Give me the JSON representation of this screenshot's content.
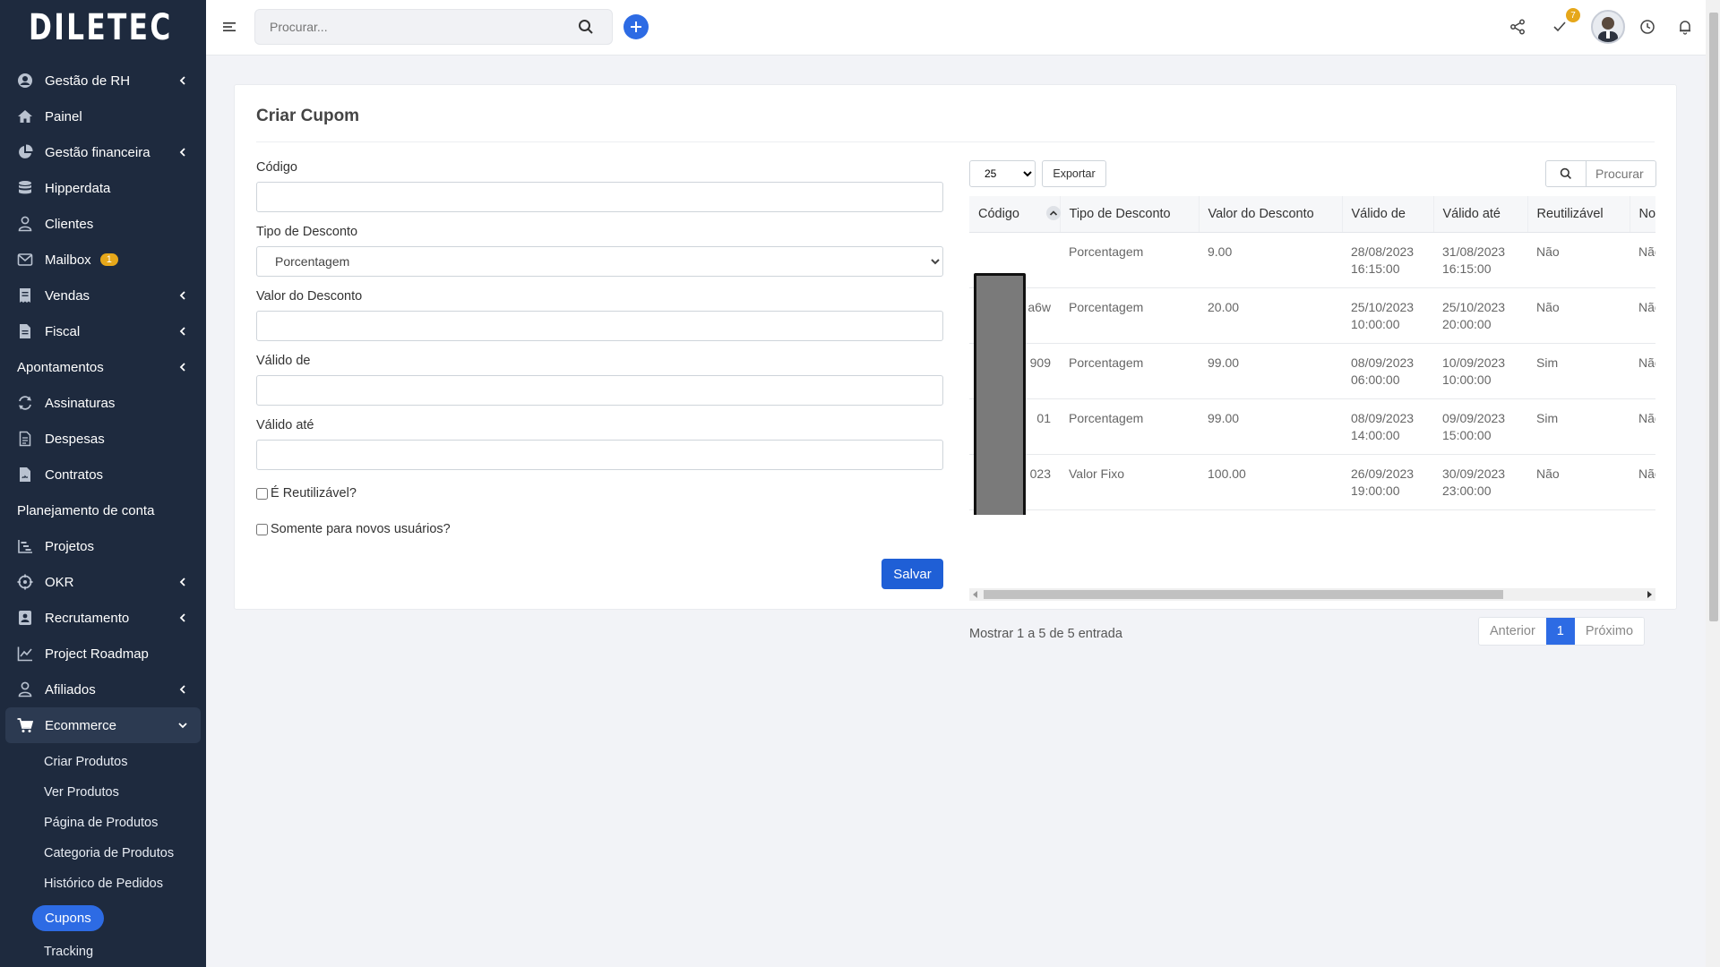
{
  "brand": {
    "name": "DILETEC"
  },
  "sidebar": {
    "items": [
      {
        "label": "Gestão de RH",
        "icon": "user-circle-icon",
        "chevron": true
      },
      {
        "label": "Painel",
        "icon": "home-icon",
        "chevron": false
      },
      {
        "label": "Gestão financeira",
        "icon": "pie-chart-icon",
        "chevron": true
      },
      {
        "label": "Hipperdata",
        "icon": "database-icon",
        "chevron": false
      },
      {
        "label": "Clientes",
        "icon": "user-icon",
        "chevron": false
      },
      {
        "label": "Mailbox",
        "icon": "envelope-icon",
        "chevron": false,
        "badge": "1"
      },
      {
        "label": "Vendas",
        "icon": "receipt-icon",
        "chevron": true
      },
      {
        "label": "Fiscal",
        "icon": "document-icon",
        "chevron": true
      },
      {
        "label": "Apontamentos",
        "icon": "",
        "chevron": true
      },
      {
        "label": "Assinaturas",
        "icon": "refresh-icon",
        "chevron": false
      },
      {
        "label": "Despesas",
        "icon": "file-icon",
        "chevron": false
      },
      {
        "label": "Contratos",
        "icon": "contract-icon",
        "chevron": false
      },
      {
        "label": "Planejamento de conta",
        "icon": "",
        "chevron": false
      },
      {
        "label": "Projetos",
        "icon": "chart-steps-icon",
        "chevron": false
      },
      {
        "label": "OKR",
        "icon": "crosshair-icon",
        "chevron": true
      },
      {
        "label": "Recrutamento",
        "icon": "id-card-icon",
        "chevron": true
      },
      {
        "label": "Project Roadmap",
        "icon": "line-chart-icon",
        "chevron": false
      },
      {
        "label": "Afiliados",
        "icon": "user-icon",
        "chevron": true
      }
    ],
    "ecommerce": {
      "label": "Ecommerce",
      "sub": [
        "Criar Produtos",
        "Ver Produtos",
        "Página de Produtos",
        "Categoria de Produtos",
        "Histórico de Pedidos"
      ],
      "active_sub": "Cupons",
      "after": "Tracking"
    }
  },
  "topbar": {
    "search_placeholder": "Procurar...",
    "tasks_badge": "7"
  },
  "page": {
    "title": "Criar Cupom",
    "form": {
      "codigo_label": "Código",
      "tipo_label": "Tipo de Desconto",
      "tipo_selected": "Porcentagem",
      "valor_label": "Valor do Desconto",
      "valido_de_label": "Válido de",
      "valido_ate_label": "Válido até",
      "reutilizavel_label": "É Reutilizável?",
      "novos_label": "Somente para novos usuários?",
      "save_label": "Salvar"
    },
    "table": {
      "page_length": "25",
      "export_label": "Exportar",
      "search_placeholder": "Procurar",
      "columns": [
        "Código",
        "Tipo de Desconto",
        "Valor do Desconto",
        "Válido de",
        "Válido até",
        "Reutilizável",
        "Novos"
      ],
      "rows": [
        [
          "",
          "Porcentagem",
          "9.00",
          "28/08/2023\n16:15:00",
          "31/08/2023\n16:15:00",
          "Não",
          "Não"
        ],
        [
          "a6w",
          "Porcentagem",
          "20.00",
          "25/10/2023\n10:00:00",
          "25/10/2023\n20:00:00",
          "Não",
          "Não"
        ],
        [
          "909",
          "Porcentagem",
          "99.00",
          "08/09/2023\n06:00:00",
          "10/09/2023\n10:00:00",
          "Sim",
          "Não"
        ],
        [
          "01",
          "Porcentagem",
          "99.00",
          "08/09/2023\n14:00:00",
          "09/09/2023\n15:00:00",
          "Sim",
          "Não"
        ],
        [
          "023",
          "Valor Fixo",
          "100.00",
          "26/09/2023\n19:00:00",
          "30/09/2023\n23:00:00",
          "Não",
          "Não"
        ]
      ],
      "info": "Mostrar 1 a 5 de 5 entrada",
      "prev": "Anterior",
      "current_page": "1",
      "next": "Próximo"
    }
  },
  "colors": {
    "sidebar": "#1e2a3e",
    "accent": "#2d6be4",
    "badge": "#e6a71a"
  }
}
